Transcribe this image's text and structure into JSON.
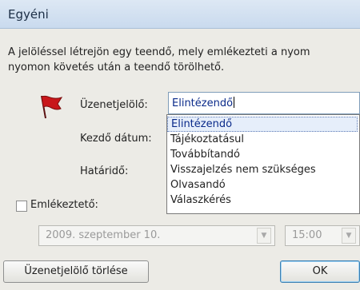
{
  "dialog": {
    "title": "Egyéni",
    "description_line1": "A jelöléssel létrejön egy teendő, mely emlékezteti a nyom",
    "description_line2": "nyomon követés után a teendő törölhető."
  },
  "fields": {
    "flag_label": "Üzenetjelölő:",
    "flag_value": "Elintézendő",
    "start_label": "Kezdő dátum:",
    "due_label": "Határidő:",
    "reminder_label": "Emlékeztető:",
    "reminder_checked": false,
    "reminder_date": "2009. szeptember 10.",
    "reminder_time": "15:00"
  },
  "dropdown": {
    "items": [
      {
        "label": "Elintézendő",
        "selected": true
      },
      {
        "label": "Tájékoztatásul",
        "selected": false
      },
      {
        "label": "Továbbítandó",
        "selected": false
      },
      {
        "label": "Visszajelzés nem szükséges",
        "selected": false
      },
      {
        "label": "Olvasandó",
        "selected": false
      },
      {
        "label": "Válaszkérés",
        "selected": false
      }
    ]
  },
  "buttons": {
    "clear_label": "Üzenetjelölő törlése",
    "ok_label": "OK"
  },
  "colors": {
    "flag": "#c8171b",
    "selection": "#e6eefa"
  },
  "icons": {
    "flag": "red-flag-icon",
    "dropdown_arrow": "chevron-down-icon"
  }
}
